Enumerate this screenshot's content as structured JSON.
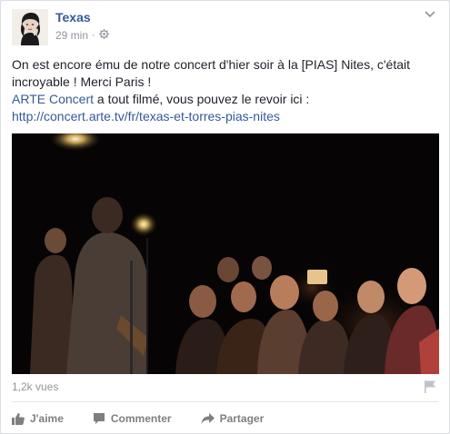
{
  "post": {
    "page_name": "Texas",
    "time": "29 min",
    "separator": "·",
    "audience_icon": "globe-icon",
    "menu_icon": "chevron-down-icon",
    "text_line1": "On est encore ému de notre concert d'hier soir à la [PIAS] Nites, c'était incroyable ! Merci Paris !",
    "mention": "ARTE Concert",
    "text_line2_rest": " a tout filmé, vous pouvez le revoir ici :",
    "url": "http://concert.arte.tv/fr/texas-et-torres-pias-nites",
    "views": "1,2k vues"
  },
  "actions": {
    "like": "J'aime",
    "comment": "Commenter",
    "share": "Partager"
  },
  "colors": {
    "link": "#365899",
    "meta": "#90949c",
    "action": "#7f7f7f"
  }
}
